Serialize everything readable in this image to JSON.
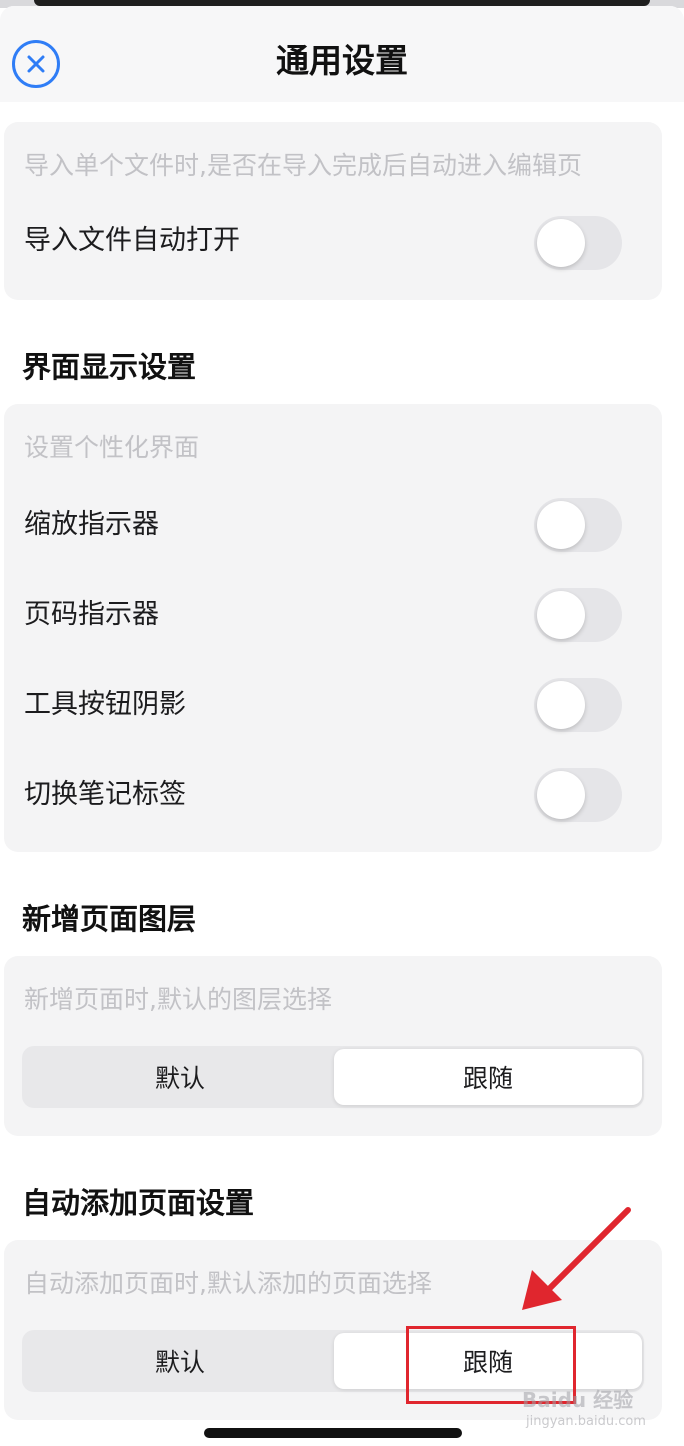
{
  "header": {
    "title": "通用设置",
    "close_icon": "close-circle-icon",
    "accent_color": "#2f7df6"
  },
  "import_card": {
    "description": "导入单个文件时,是否在导入完成后自动进入编辑页",
    "toggle_label": "导入文件自动打开",
    "toggle_on": false
  },
  "display_section": {
    "title": "界面显示设置",
    "description": "设置个性化界面",
    "toggles": [
      {
        "label": "缩放指示器",
        "on": false
      },
      {
        "label": "页码指示器",
        "on": false
      },
      {
        "label": "工具按钮阴影",
        "on": false
      },
      {
        "label": "切换笔记标签",
        "on": false
      }
    ]
  },
  "new_page_layer_section": {
    "title": "新增页面图层",
    "description": "新增页面时,默认的图层选择",
    "options": [
      "默认",
      "跟随"
    ],
    "selected": "跟随"
  },
  "auto_add_page_section": {
    "title": "自动添加页面设置",
    "description": "自动添加页面时,默认添加的页面选择",
    "options": [
      "默认",
      "跟随"
    ],
    "selected": "跟随"
  },
  "annotation": {
    "highlight_color": "#e0262e"
  },
  "watermark": {
    "text": "Baidu 经验",
    "sub": "jingyan.baidu.com"
  }
}
